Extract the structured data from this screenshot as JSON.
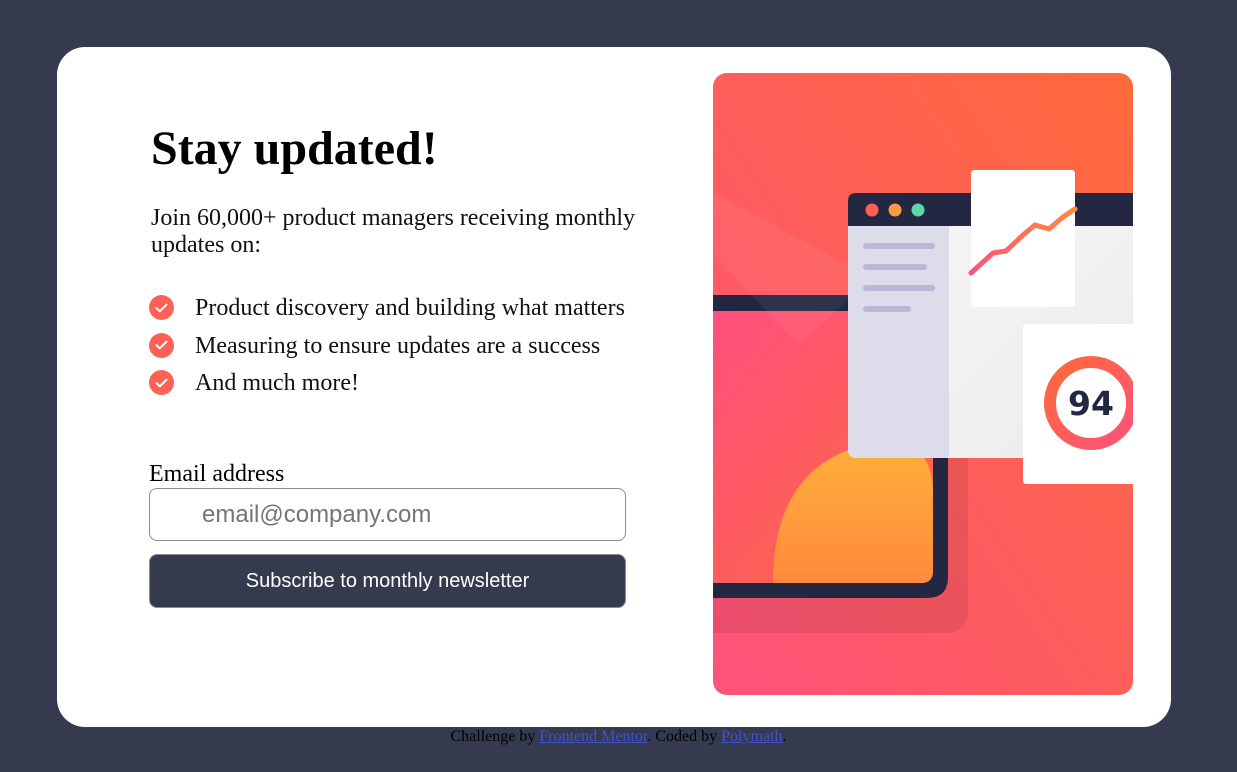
{
  "card": {
    "title": "Stay updated!",
    "intro": "Join 60,000+ product managers receiving monthly updates on:",
    "features": [
      "Product discovery and building what matters",
      "Measuring to ensure updates are a success",
      "And much more!"
    ],
    "email_label": "Email address",
    "email_placeholder": "email@company.com",
    "email_value": "",
    "subscribe_label": "Subscribe to monthly newsletter"
  },
  "illustration": {
    "score": "94",
    "icon": "dashboard-illustration"
  },
  "footer": {
    "prefix": "Challenge by ",
    "link1": "Frontend Mentor",
    "middle": ". Coded by ",
    "link2": "Polymath",
    "suffix": "."
  },
  "colors": {
    "background": "#363a4f",
    "card": "#ffffff",
    "accent": "#ff6155",
    "button": "#363a4f"
  }
}
